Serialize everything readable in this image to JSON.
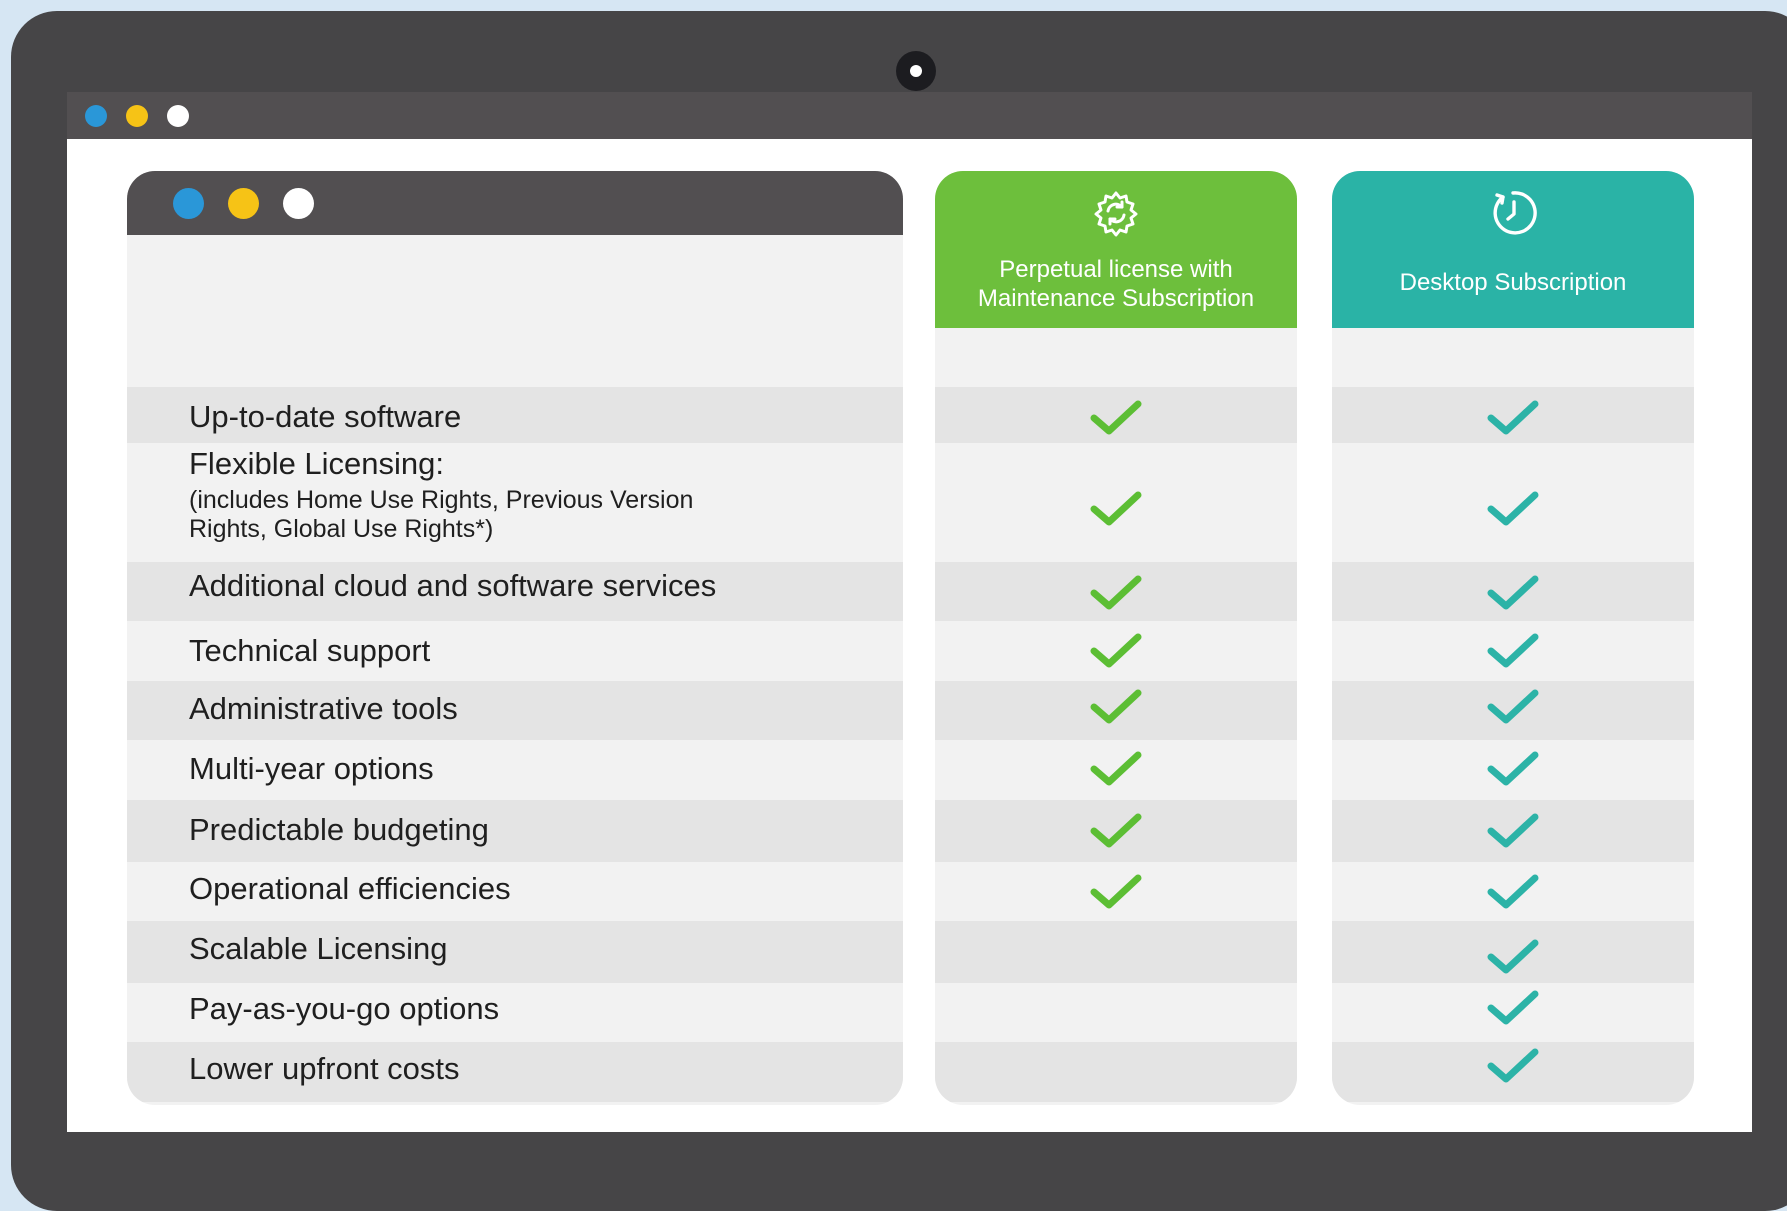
{
  "colors": {
    "background": "#d6e6f3",
    "device": "#464547",
    "titlebar": "#524f51",
    "dot_blue": "#2a97d8",
    "dot_yellow": "#f6c316",
    "dot_white": "#ffffff",
    "perpetual_header": "#6dbf3c",
    "desktop_header": "#2ab3a6",
    "check_green": "#5cbe34",
    "check_teal": "#2cb3a7",
    "row_shade": "#e4e4e4",
    "row_plain": "#f2f2f2"
  },
  "columns": [
    {
      "key": "perpetual",
      "icon": "gear-refresh-icon",
      "label_lines": [
        "Perpetual license with",
        "Maintenance Subscription"
      ]
    },
    {
      "key": "desktop",
      "icon": "clock-refresh-icon",
      "label": "Desktop Subscription"
    }
  ],
  "features": [
    {
      "label": "Up-to-date software",
      "perpetual": true,
      "desktop": true
    },
    {
      "label": "Flexible Licensing:",
      "sub_lines": [
        "(includes Home Use Rights, Previous Version",
        "Rights, Global Use Rights*)"
      ],
      "perpetual": true,
      "desktop": true
    },
    {
      "label": "Additional cloud and software services",
      "perpetual": true,
      "desktop": true
    },
    {
      "label": "Technical support",
      "perpetual": true,
      "desktop": true
    },
    {
      "label": "Administrative tools",
      "perpetual": true,
      "desktop": true
    },
    {
      "label": "Multi-year options",
      "perpetual": true,
      "desktop": true
    },
    {
      "label": "Predictable budgeting",
      "perpetual": true,
      "desktop": true
    },
    {
      "label": "Operational efficiencies",
      "perpetual": true,
      "desktop": true
    },
    {
      "label": "Scalable Licensing",
      "perpetual": false,
      "desktop": true
    },
    {
      "label": "Pay-as-you-go options",
      "perpetual": false,
      "desktop": true
    },
    {
      "label": "Lower upfront costs",
      "perpetual": false,
      "desktop": true
    }
  ]
}
